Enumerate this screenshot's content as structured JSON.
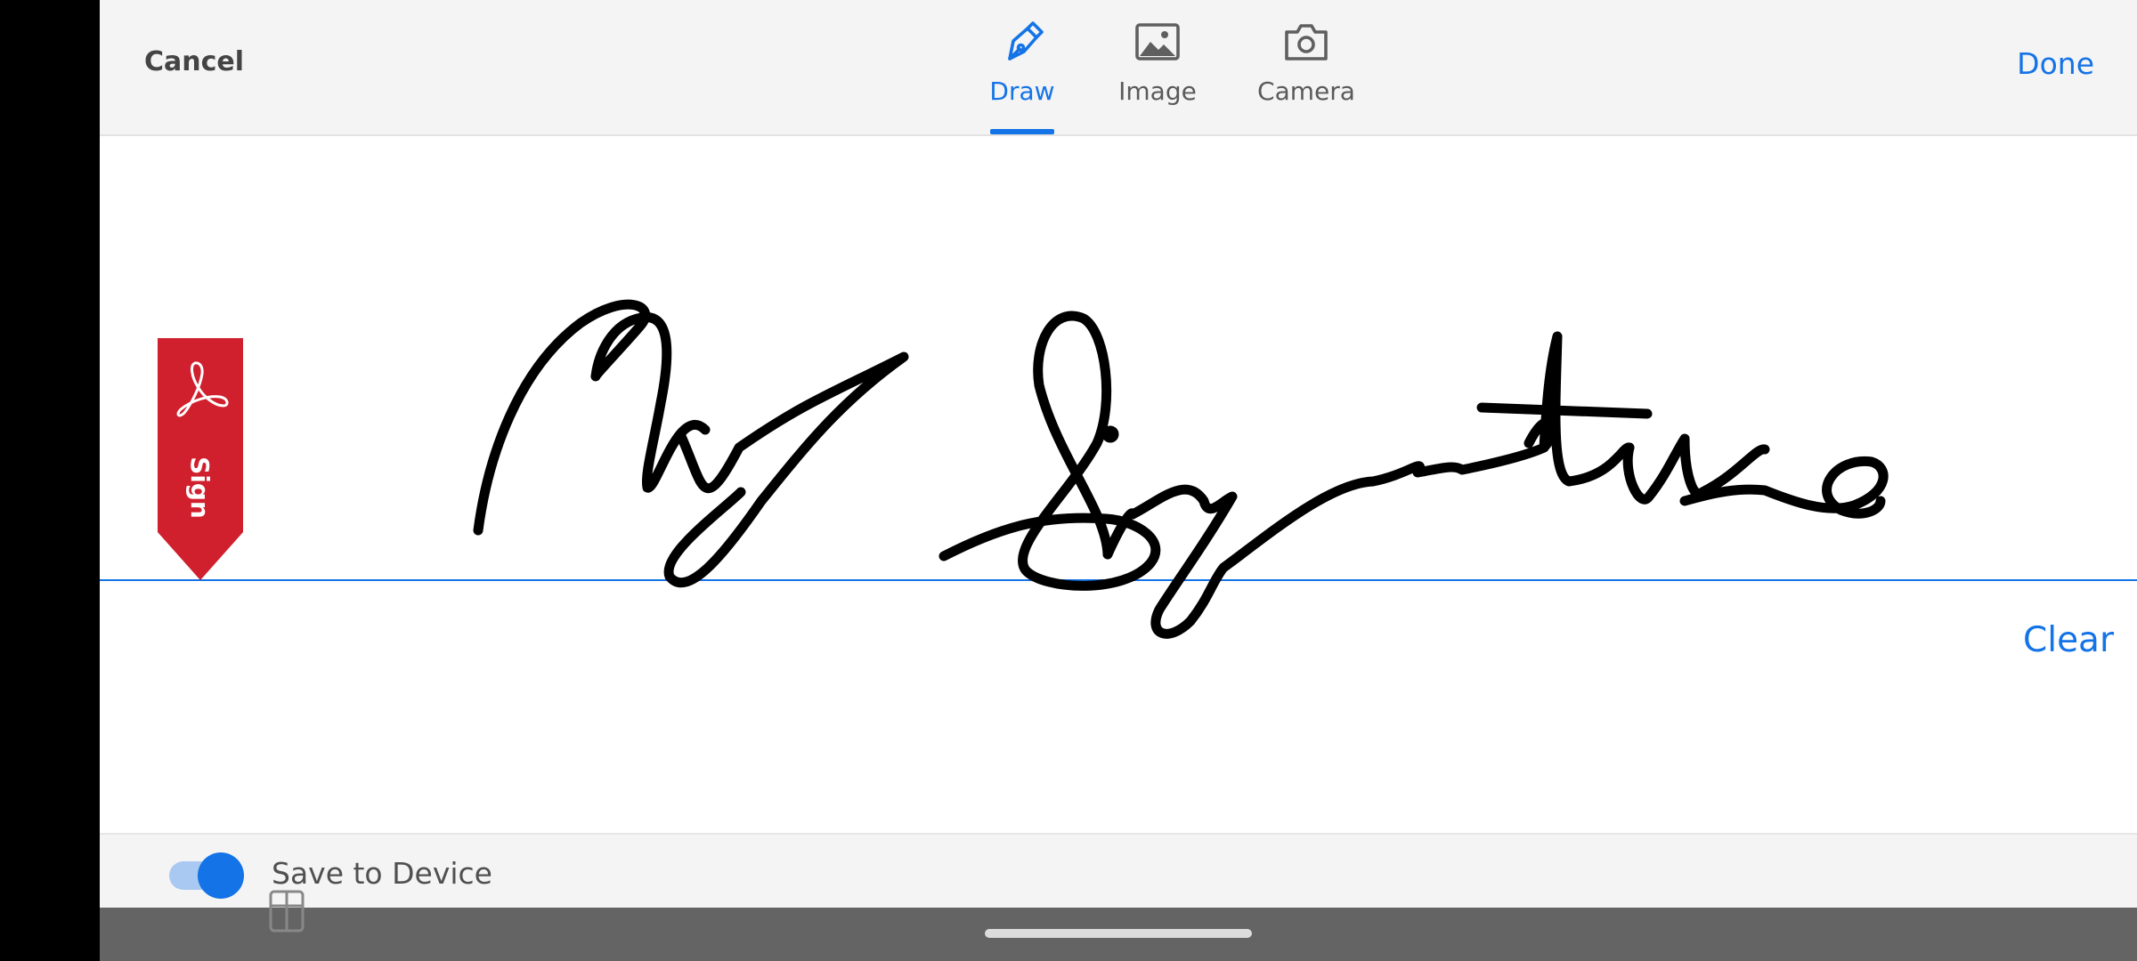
{
  "header": {
    "cancel_label": "Cancel",
    "done_label": "Done",
    "tabs": [
      {
        "label": "Draw",
        "icon": "pen-nib-icon",
        "active": true
      },
      {
        "label": "Image",
        "icon": "image-icon",
        "active": false
      },
      {
        "label": "Camera",
        "icon": "camera-icon",
        "active": false
      }
    ]
  },
  "canvas": {
    "sign_flag_label": "Sign",
    "clear_label": "Clear",
    "signature_text": "My Signature"
  },
  "footer": {
    "save_to_device_label": "Save to Device",
    "save_to_device_enabled": true
  },
  "colors": {
    "accent": "#1473e6",
    "sign_flag": "#d0202e",
    "ink": "#000000",
    "header_bg": "#f4f4f4"
  }
}
